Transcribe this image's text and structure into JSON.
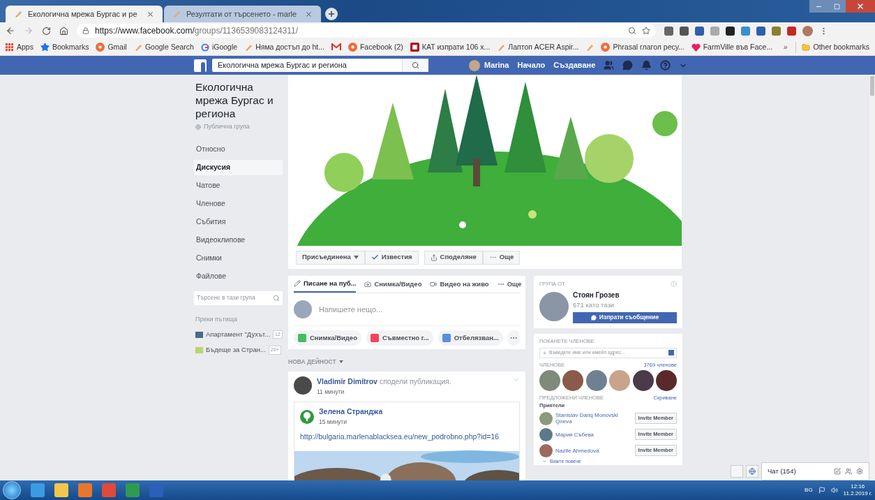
{
  "browser": {
    "tabs": [
      {
        "title": "Екологична мрежа Бургас и ре",
        "selected": true
      },
      {
        "title": "Резултати от търсенето - marle",
        "selected": false
      }
    ],
    "url": {
      "host": "https://www.facebook.com/",
      "path": "groups/1136539083124311/"
    },
    "bookmarks": [
      {
        "kind": "apps",
        "label": "Apps"
      },
      {
        "kind": "star",
        "label": "Bookmarks"
      },
      {
        "kind": "flower",
        "label": "Gmail"
      },
      {
        "kind": "pen",
        "label": "Google Search"
      },
      {
        "kind": "google",
        "label": "iGoogle"
      },
      {
        "kind": "pen",
        "label": "Няма достъп до ht..."
      },
      {
        "kind": "mail"
      },
      {
        "kind": "flower",
        "label": "Facebook (2)"
      },
      {
        "kind": "red",
        "label": "КАТ изпрати 106 х..."
      },
      {
        "kind": "pen",
        "label": "Лаптоп ACER Aspir..."
      },
      {
        "kind": "pen"
      },
      {
        "kind": "flower",
        "label": "Phrasal глагол ресу..."
      },
      {
        "kind": "heart",
        "label": "FarmVille във Face..."
      }
    ],
    "more_bookmarks": "»",
    "other_bookmarks": "Other bookmarks"
  },
  "facebook_bar": {
    "search_value": "Екологична мрежа Бургас и региона",
    "user": "Marina",
    "links": [
      "Начало",
      "Създаване"
    ]
  },
  "sidebar": {
    "group_name": "Екологична мрежа Бургас и региона",
    "privacy": "Публична група",
    "items": [
      {
        "label": "Относно",
        "selected": false
      },
      {
        "label": "Дискусия",
        "selected": true
      },
      {
        "label": "Чатове",
        "selected": false
      },
      {
        "label": "Членове",
        "selected": false
      },
      {
        "label": "Събития",
        "selected": false
      },
      {
        "label": "Видеоклипове",
        "selected": false
      },
      {
        "label": "Снимки",
        "selected": false
      },
      {
        "label": "Файлове",
        "selected": false
      }
    ],
    "search_placeholder": "Търсене в тази група",
    "shortcuts_title": "Преки пътища",
    "shortcuts": [
      {
        "label": "Апартамент \"Духът...",
        "count": "12"
      },
      {
        "label": "Бъдеще за Стран...",
        "count": "20+"
      }
    ]
  },
  "group_actions": [
    {
      "kind": "dropdown",
      "label": "Присъединена"
    },
    {
      "kind": "check",
      "label": "Известия"
    },
    {
      "kind": "share",
      "label": "Споделяне"
    },
    {
      "kind": "more",
      "label": "Още"
    }
  ],
  "composer": {
    "tabs": [
      {
        "label": "Писане на пуб...",
        "selected": true
      },
      {
        "label": "Снимка/Видео",
        "selected": false
      },
      {
        "label": "Видео на живо",
        "selected": false
      },
      {
        "label": "Още",
        "selected": false
      }
    ],
    "placeholder": "Напишете нещо...",
    "actions": [
      "Снимка/Видео",
      "Съвместно г...",
      "Отбелязван..."
    ]
  },
  "feed": {
    "heading": "НОВА ДЕЙНОСТ",
    "post": {
      "author": "Vladimir Dimitrov",
      "action": "сподели публикация.",
      "time": "11 минути",
      "shared": {
        "author": "Зелена Странджа",
        "time": "15 минути",
        "link": "http://bulgaria.marlenablacksea.eu/new_podrobno.php?id=16"
      }
    }
  },
  "group_by": {
    "heading": "ГРУПА ОТ",
    "name": "Стоян Грозев",
    "likes": "671 като тази",
    "button": "Изпрати съобщение"
  },
  "invite": {
    "heading": "ПОКАНЕТЕ ЧЛЕНОВЕ",
    "placeholder": "Въведете име или имейл адрес...",
    "members_label": "ЧЛЕНОВЕ",
    "members_count": "3769 членове",
    "suggested_label": "ПРЕДЛОЖЕНИ ЧЛЕНОВЕ",
    "hide": "Скриване",
    "friends_label": "Приятели",
    "suggestions": [
      {
        "name": "Stanislav Dariq Monovski Qneva",
        "button": "Invite Member"
      },
      {
        "name": "Мария Събева",
        "button": "Invite Member"
      },
      {
        "name": "Nazife Ahmedova",
        "button": "Invite Member"
      }
    ],
    "see_more": "Вижте повече"
  },
  "chat": {
    "label": "Чат (154)"
  },
  "taskbar": {
    "language": "BG",
    "time": "12:16",
    "date": "11.2.2019 г."
  }
}
